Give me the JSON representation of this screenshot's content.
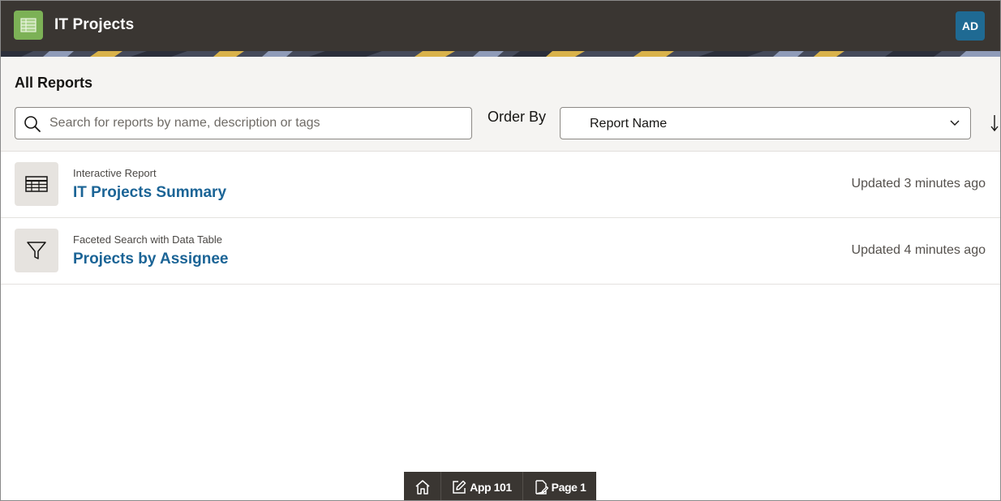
{
  "header": {
    "app_title": "IT Projects",
    "user_initials": "AD",
    "logo_icon": "report-grid-icon",
    "logo_color": "#7cb156",
    "avatar_color": "#1f6a93",
    "bar_color": "#3a3632"
  },
  "region": {
    "title": "All Reports",
    "search": {
      "placeholder": "Search for reports by name, description or tags",
      "value": ""
    },
    "order_by": {
      "label": "Order By",
      "selected": "Report Name"
    }
  },
  "reports": [
    {
      "type": "Interactive Report",
      "name": "IT Projects Summary",
      "updated": "Updated 3 minutes ago",
      "icon": "table-icon"
    },
    {
      "type": "Faceted Search with Data Table",
      "name": "Projects by Assignee",
      "updated": "Updated 4 minutes ago",
      "icon": "filter-icon"
    }
  ],
  "dev_toolbar": {
    "home_icon": "home-icon",
    "app_label": "App 101",
    "page_label": "Page 1"
  },
  "colors": {
    "link": "#1b6496",
    "region_bg": "#f5f4f2",
    "icon_tile_bg": "#e6e3df"
  }
}
